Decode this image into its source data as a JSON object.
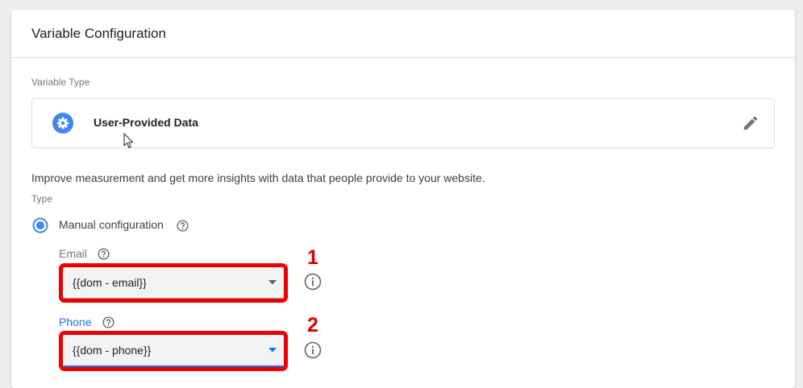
{
  "header": {
    "title": "Variable Configuration"
  },
  "variable_type": {
    "label": "Variable Type",
    "name": "User-Provided Data",
    "icon": "gear-icon",
    "edit_icon": "pencil-icon"
  },
  "description": "Improve measurement and get more insights with data that people provide to your website.",
  "type_section": {
    "label": "Type",
    "option_label": "Manual configuration",
    "selected": true
  },
  "fields": {
    "email": {
      "label": "Email",
      "value": "{{dom - email}}",
      "callout": "1"
    },
    "phone": {
      "label": "Phone",
      "value": "{{dom - phone}}",
      "callout": "2"
    }
  },
  "colors": {
    "accent": "#1a73e8",
    "radio": "#4285f4",
    "highlight": "#f20000",
    "callout_text": "#e00000"
  }
}
